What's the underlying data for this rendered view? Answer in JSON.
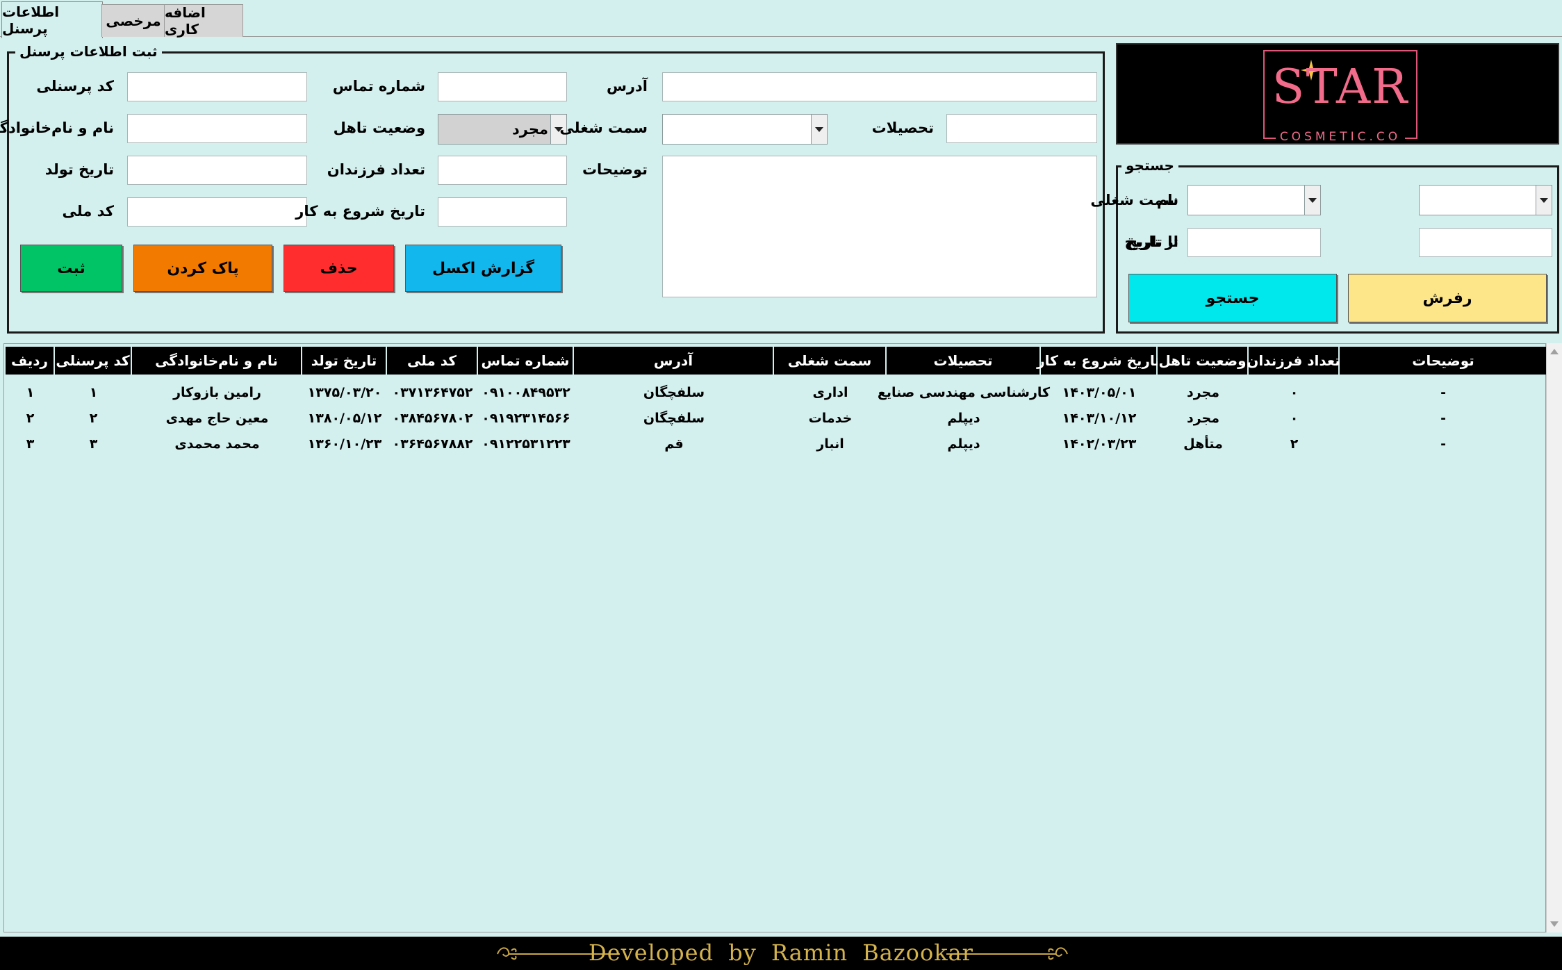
{
  "tabs": [
    {
      "label": "اطلاعات پرسنل",
      "active": true
    },
    {
      "label": "مرخصی",
      "active": false
    },
    {
      "label": "اضافه کاری",
      "active": false
    }
  ],
  "form": {
    "title": "ثبت اطلاعات پرسنل",
    "labels": {
      "personnel_code": "کد پرسنلی",
      "full_name": "نام و نام‌خانوادگی",
      "birth_date": "تاریخ تولد",
      "national_code": "کد ملی",
      "phone": "شماره تماس",
      "marital_status": "وضعیت تاهل",
      "children": "تعداد فرزندان",
      "start_date": "تاریخ شروع به کار",
      "address": "آدرس",
      "job_position": "سمت شغلی",
      "education": "تحصیلات",
      "description": "توضیحات"
    },
    "marital_status_value": "مجرد",
    "job_position_value": "",
    "buttons": {
      "submit": "ثبت",
      "clear": "پاک کردن",
      "delete": "حذف",
      "excel": "گزارش اکسل"
    }
  },
  "logo": {
    "main": "STAR",
    "sub": "COSMETIC.CO"
  },
  "search": {
    "title": "جستجو",
    "labels": {
      "name": "نام",
      "job_position": "سمت شغلی",
      "from_date": "از تاریخ",
      "to_date": "تا تاریخ"
    },
    "buttons": {
      "search": "جستجو",
      "refresh": "رفرش"
    }
  },
  "table": {
    "columns": [
      "ردیف",
      "کد پرسنلی",
      "نام و نام‌خانوادگی",
      "تاریخ تولد",
      "کد ملی",
      "شماره تماس",
      "آدرس",
      "سمت شغلی",
      "تحصیلات",
      "تاریخ شروع به کار",
      "وضعیت تاهل",
      "تعداد فرزندان",
      "توضیحات"
    ],
    "rows": [
      [
        "۱",
        "۱",
        "رامین بازوکار",
        "۱۳۷۵/۰۳/۲۰",
        "۰۳۷۱۳۶۴۷۵۲",
        "۰۹۱۰۰۸۴۹۵۳۲",
        "سلفچگان",
        "اداری",
        "کارشناسی مهندسی صنایع",
        "۱۴۰۳/۰۵/۰۱",
        "مجرد",
        "۰",
        "-"
      ],
      [
        "۲",
        "۲",
        "معین حاج مهدی",
        "۱۳۸۰/۰۵/۱۲",
        "۰۳۸۴۵۶۷۸۰۲",
        "۰۹۱۹۲۳۱۴۵۶۶",
        "سلفچگان",
        "خدمات",
        "دیپلم",
        "۱۴۰۳/۱۰/۱۲",
        "مجرد",
        "۰",
        "-"
      ],
      [
        "۳",
        "۳",
        "محمد محمدی",
        "۱۳۶۰/۱۰/۲۳",
        "۰۳۶۴۵۶۷۸۸۲",
        "۰۹۱۲۲۵۳۱۲۲۳",
        "قم",
        "انبار",
        "دیپلم",
        "۱۴۰۲/۰۳/۲۳",
        "متأهل",
        "۲",
        "-"
      ]
    ]
  },
  "footer": {
    "text": "Developed by Ramin Bazookar"
  }
}
